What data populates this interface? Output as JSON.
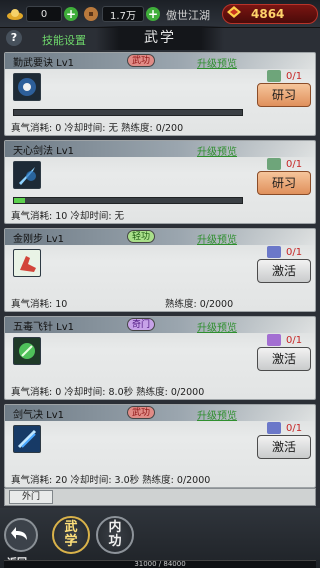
{
  "topbar": {
    "gold_value": "0",
    "silver_value": "1.7万",
    "server_name": "傲世江湖",
    "power_value": "4864"
  },
  "header": {
    "help_label": "?",
    "skill_setting": "技能设置",
    "title": "武学"
  },
  "skills": [
    {
      "name": "勤武要诀 Lv1",
      "tag": "武功",
      "preview": "升级预览",
      "book_count": "0/1",
      "button": "研习",
      "show_bar": true,
      "progress": 0,
      "stats": "真气消耗: 0   冷却时间: 无   熟练度: 0/200",
      "mastery": ""
    },
    {
      "name": "天心剑法 Lv1",
      "tag": "",
      "preview": "升级预览",
      "book_count": "0/1",
      "button": "研习",
      "show_bar": true,
      "progress": 0.05,
      "stats": "真气消耗: 10   冷却时间: 无",
      "mastery": ""
    },
    {
      "name": "金刚步 Lv1",
      "tag": "轻功",
      "preview": "升级预览",
      "book_count": "0/1",
      "button": "激活",
      "show_bar": false,
      "stats": "真气消耗: 10",
      "mastery": "熟练度: 0/2000"
    },
    {
      "name": "五毒飞针 Lv1",
      "tag": "奇门",
      "preview": "升级预览",
      "book_count": "0/1",
      "button": "激活",
      "show_bar": false,
      "stats": "真气消耗: 0   冷却时间: 8.0秒   熟练度: 0/2000",
      "mastery": ""
    },
    {
      "name": "剑气决 Lv1",
      "tag": "武功",
      "preview": "升级预览",
      "book_count": "0/1",
      "button": "激活",
      "show_bar": false,
      "stats": "真气消耗: 20   冷却时间: 3.0秒   熟练度: 0/2000",
      "mastery": ""
    }
  ],
  "tabs": {
    "outer": "外门"
  },
  "bottom": {
    "back_label": "返回",
    "tab_martial": "武学",
    "tab_inner": "内功",
    "exp_text": "31000 / 84000"
  },
  "colors": {
    "accent_green": "#5bd04d",
    "study_button": "#e0905c",
    "power_gold": "#ffd36b"
  }
}
